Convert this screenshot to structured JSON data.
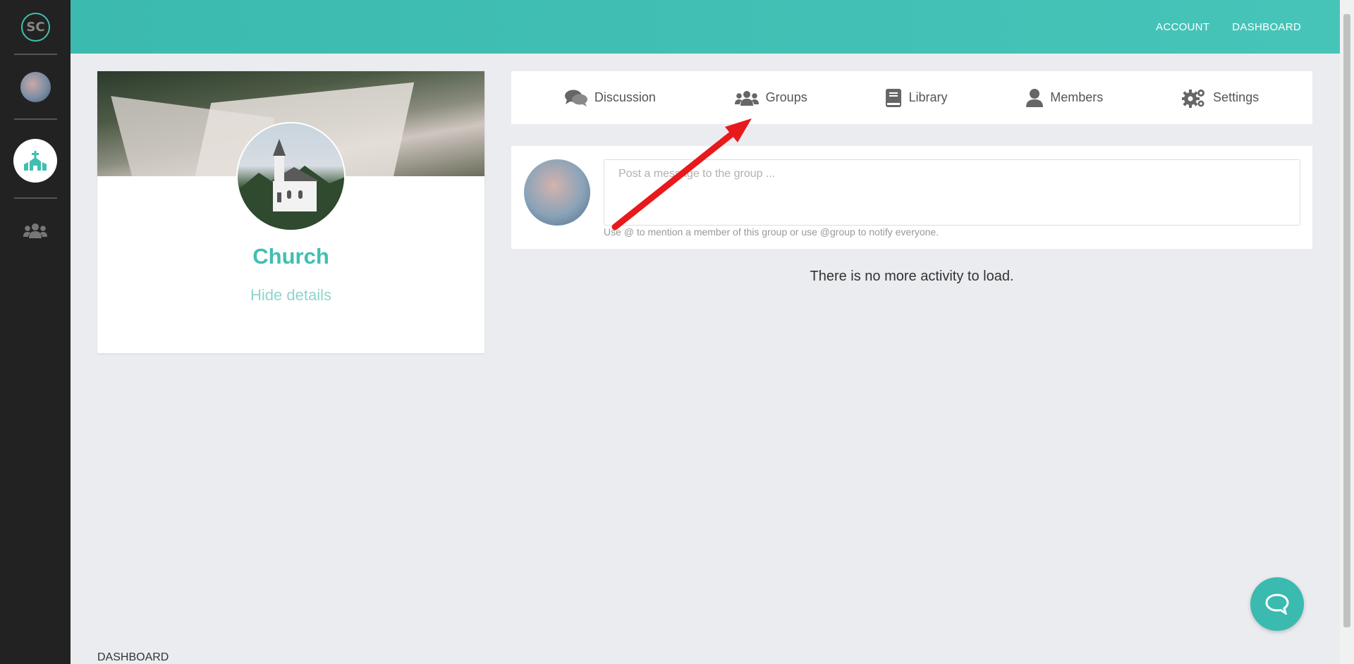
{
  "sidebar": {
    "logo_text": "SC",
    "items": [
      {
        "name": "profile-avatar"
      },
      {
        "name": "church-group",
        "active": true
      },
      {
        "name": "people"
      }
    ]
  },
  "topbar": {
    "nav": [
      {
        "label": "ACCOUNT"
      },
      {
        "label": "DASHBOARD"
      }
    ]
  },
  "group": {
    "name": "Church",
    "toggle_label": "Hide details"
  },
  "tabs": [
    {
      "label": "Discussion",
      "icon": "comments-icon"
    },
    {
      "label": "Groups",
      "icon": "users-icon"
    },
    {
      "label": "Library",
      "icon": "book-icon"
    },
    {
      "label": "Members",
      "icon": "user-icon"
    },
    {
      "label": "Settings",
      "icon": "gears-icon"
    }
  ],
  "composer": {
    "placeholder": "Post a message to the group ...",
    "hint": "Use @ to mention a member of this group or use @group to notify everyone."
  },
  "feed": {
    "empty_message": "There is no more activity to load."
  },
  "footer": {
    "link": "DASHBOARD"
  },
  "colors": {
    "accent": "#40bfb0",
    "rail": "#222222",
    "background": "#ebecf0",
    "annotation": "#e8191c"
  }
}
